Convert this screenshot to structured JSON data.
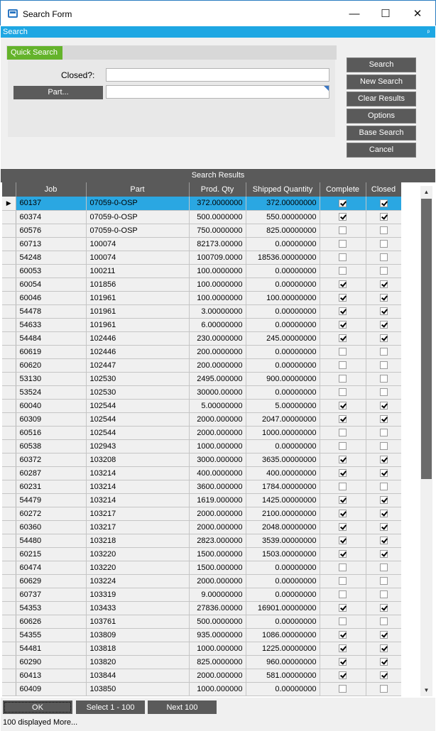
{
  "window": {
    "title": "Search Form",
    "minimize": "—",
    "maximize": "☐",
    "close": "✕"
  },
  "search_strip": {
    "label": "Search",
    "pin": "ᵖ"
  },
  "quick_search": {
    "tab_label": "Quick Search",
    "closed_label": "Closed?:",
    "closed_value": "",
    "part_button": "Part...",
    "part_value": ""
  },
  "side_buttons": {
    "search": "Search",
    "new_search": "New Search",
    "clear_results": "Clear Results",
    "options": "Options",
    "base_search": "Base Search",
    "cancel": "Cancel"
  },
  "results": {
    "header": "Search Results",
    "columns": [
      "Job",
      "Part",
      "Prod. Qty",
      "Shipped Quantity",
      "Complete",
      "Closed"
    ],
    "rows": [
      [
        "60137",
        "07059-0-OSP",
        "372.0000000",
        "372.00000000",
        true,
        true
      ],
      [
        "60374",
        "07059-0-OSP",
        "500.0000000",
        "550.00000000",
        true,
        true
      ],
      [
        "60576",
        "07059-0-OSP",
        "750.0000000",
        "825.00000000",
        false,
        false
      ],
      [
        "60713",
        "100074",
        "82173.00000",
        "0.00000000",
        false,
        false
      ],
      [
        "54248",
        "100074",
        "100709.0000",
        "18536.00000000",
        false,
        false
      ],
      [
        "60053",
        "100211",
        "100.0000000",
        "0.00000000",
        false,
        false
      ],
      [
        "60054",
        "101856",
        "100.0000000",
        "0.00000000",
        true,
        true
      ],
      [
        "60046",
        "101961",
        "100.0000000",
        "100.00000000",
        true,
        true
      ],
      [
        "54478",
        "101961",
        "3.00000000",
        "0.00000000",
        true,
        true
      ],
      [
        "54633",
        "101961",
        "6.00000000",
        "0.00000000",
        true,
        true
      ],
      [
        "54484",
        "102446",
        "230.0000000",
        "245.00000000",
        true,
        true
      ],
      [
        "60619",
        "102446",
        "200.0000000",
        "0.00000000",
        false,
        false
      ],
      [
        "60620",
        "102447",
        "200.0000000",
        "0.00000000",
        false,
        false
      ],
      [
        "53130",
        "102530",
        "2495.000000",
        "900.00000000",
        false,
        false
      ],
      [
        "53524",
        "102530",
        "30000.00000",
        "0.00000000",
        false,
        false
      ],
      [
        "60040",
        "102544",
        "5.00000000",
        "5.00000000",
        true,
        true
      ],
      [
        "60309",
        "102544",
        "2000.000000",
        "2047.00000000",
        true,
        true
      ],
      [
        "60516",
        "102544",
        "2000.000000",
        "1000.00000000",
        false,
        false
      ],
      [
        "60538",
        "102943",
        "1000.000000",
        "0.00000000",
        false,
        false
      ],
      [
        "60372",
        "103208",
        "3000.000000",
        "3635.00000000",
        true,
        true
      ],
      [
        "60287",
        "103214",
        "400.0000000",
        "400.00000000",
        true,
        true
      ],
      [
        "60231",
        "103214",
        "3600.000000",
        "1784.00000000",
        false,
        false
      ],
      [
        "54479",
        "103214",
        "1619.000000",
        "1425.00000000",
        true,
        true
      ],
      [
        "60272",
        "103217",
        "2000.000000",
        "2100.00000000",
        true,
        true
      ],
      [
        "60360",
        "103217",
        "2000.000000",
        "2048.00000000",
        true,
        true
      ],
      [
        "54480",
        "103218",
        "2823.000000",
        "3539.00000000",
        true,
        true
      ],
      [
        "60215",
        "103220",
        "1500.000000",
        "1503.00000000",
        true,
        true
      ],
      [
        "60474",
        "103220",
        "1500.000000",
        "0.00000000",
        false,
        false
      ],
      [
        "60629",
        "103224",
        "2000.000000",
        "0.00000000",
        false,
        false
      ],
      [
        "60737",
        "103319",
        "9.00000000",
        "0.00000000",
        false,
        false
      ],
      [
        "54353",
        "103433",
        "27836.00000",
        "16901.00000000",
        true,
        true
      ],
      [
        "60626",
        "103761",
        "500.0000000",
        "0.00000000",
        false,
        false
      ],
      [
        "54355",
        "103809",
        "935.0000000",
        "1086.00000000",
        true,
        true
      ],
      [
        "54481",
        "103818",
        "1000.000000",
        "1225.00000000",
        true,
        true
      ],
      [
        "60290",
        "103820",
        "825.0000000",
        "960.00000000",
        true,
        true
      ],
      [
        "60413",
        "103844",
        "2000.000000",
        "581.00000000",
        true,
        true
      ],
      [
        "60409",
        "103850",
        "1000.000000",
        "0.00000000",
        false,
        false
      ]
    ]
  },
  "footer": {
    "ok": "OK",
    "select_range": "Select 1 - 100",
    "next": "Next 100",
    "status": "100 displayed More..."
  }
}
